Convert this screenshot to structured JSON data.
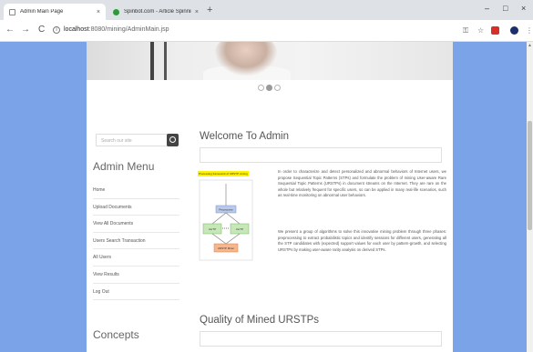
{
  "browser": {
    "tabs": [
      {
        "title": "Admin Main Page",
        "active": true
      },
      {
        "title": "Spinbot.com - Article Spinning",
        "active": false
      }
    ],
    "new_tab": "+",
    "url_host": "localhost",
    "url_path": ":8080/mining/AdminMain.jsp",
    "back": "←",
    "forward": "→",
    "reload": "C",
    "minimize": "–",
    "maximize": "□",
    "close": "×"
  },
  "sidebar": {
    "search_placeholder": "Search our site",
    "menu_title": "Admin Menu",
    "menu_items": [
      {
        "label": "Home"
      },
      {
        "label": "Upload Documents"
      },
      {
        "label": "View All Documents"
      },
      {
        "label": "Users Search Transaction"
      },
      {
        "label": "All Users"
      },
      {
        "label": "View Results"
      },
      {
        "label": "Log Out"
      }
    ],
    "concepts_title": "Concepts"
  },
  "main": {
    "welcome_title": "Welcome To Admin",
    "diagram_caption": "Processing framework of URSTP mining",
    "diagram_labels": [
      "Preprocess",
      "UsrTP",
      "UsrTP",
      "URSTP Miner"
    ],
    "para1": "In order to characterize and detect personalized and abnormal behaviors of Internet users, we propose Sequential Topic Patterns (STPs) and formulate the problem of mining User-aware Rare Sequential Topic Patterns (URSTPs) in document streams on the Internet. They are rare on the whole but relatively frequent for specific users, so can be applied in many real-life scenarios, such as real-time monitoring on abnormal user behaviors.",
    "para2": "We present a group of algorithms to solve this innovative mining problem through three phases: preprocessing to extract probabilistic topics and identify sessions for different users, generating all the STP candidates with (expected) support values for each user by pattern-growth, and selecting URSTPs by making user-aware rarity analysis on derived STPs.",
    "quality_title": "Quality of Mined URSTPs"
  },
  "colors": {
    "page_bg": "#7aa3e8",
    "content_bg": "#ffffff",
    "caption_highlight": "#fff200",
    "box_blue": "#b9c9ec",
    "box_green": "#c6e8b8",
    "box_orange": "#f6b68e"
  }
}
